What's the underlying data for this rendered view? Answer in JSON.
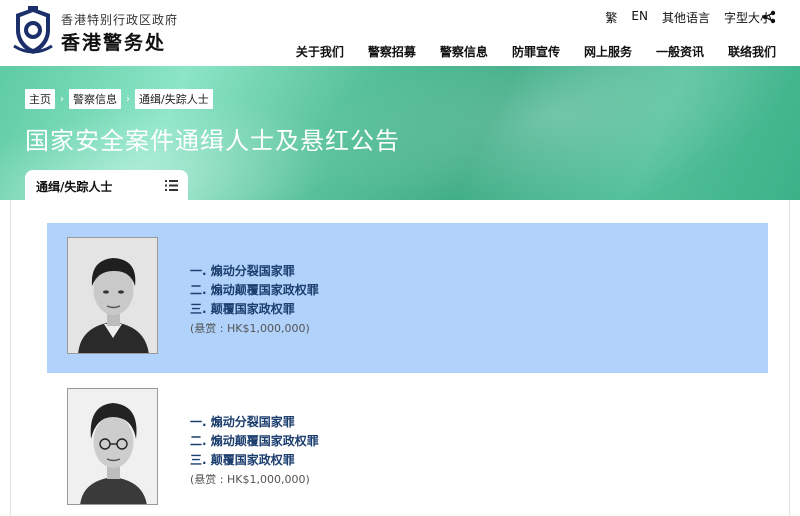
{
  "header": {
    "org_sub": "香港特别行政区政府",
    "org_main": "香港警务处",
    "utilities": [
      "繁",
      "EN",
      "其他语言",
      "字型大小"
    ]
  },
  "nav": [
    "关于我们",
    "警察招募",
    "警察信息",
    "防罪宣传",
    "网上服务",
    "一般资讯",
    "联络我们"
  ],
  "breadcrumb": [
    "主页",
    "警察信息",
    "通缉/失踪人士"
  ],
  "page_title": "国家安全案件通缉人士及悬红公告",
  "tab": {
    "label": "通缉/失踪人士"
  },
  "persons": [
    {
      "charges": [
        "一. 煽动分裂国家罪",
        "二. 煽动颠覆国家政权罪",
        "三. 颠覆国家政权罪"
      ],
      "reward": "(悬赏 : HK$1,000,000)"
    },
    {
      "charges": [
        "一. 煽动分裂国家罪",
        "二. 煽动颠覆国家政权罪",
        "三. 颠覆国家政权罪"
      ],
      "reward": "(悬赏 : HK$1,000,000)"
    }
  ],
  "colors": {
    "banner_green": "#3cb188",
    "card_highlight": "#b1d2fb",
    "charge_text": "#1d3f6f"
  }
}
